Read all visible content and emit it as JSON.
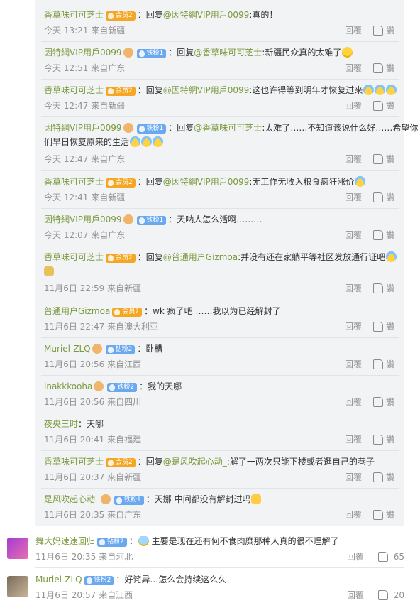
{
  "replies": [
    {
      "user": "香草味可可芝士",
      "badge": "会员2",
      "badge_color": "gold",
      "pre": "回复",
      "mention": "@因特網VIP用戶0099",
      "text": ":真的！",
      "emoji": "",
      "time": "今天 13:21",
      "from": "来自新疆",
      "reply_label": "回覆",
      "like_label": "讚"
    },
    {
      "user": "因特網VIP用戶0099",
      "badge": "铁粉1",
      "badge_color": "blue",
      "pre": "回复",
      "mention": "@香草味可可芝士",
      "text": ":新疆民众真的太难了",
      "emoji": "emoji",
      "time": "今天 12:51",
      "from": "来自广东",
      "reply_label": "回覆",
      "like_label": "讚"
    },
    {
      "user": "香草味可可芝士",
      "badge": "会员2",
      "badge_color": "gold",
      "pre": "回复",
      "mention": "@因特網VIP用戶0099",
      "text": ":这也许得等到明年才恢复过来",
      "emoji": "cry3",
      "time": "今天 12:47",
      "from": "来自新疆",
      "reply_label": "回覆",
      "like_label": "讚"
    },
    {
      "user": "因特網VIP用戶0099",
      "badge": "铁粉1",
      "badge_color": "blue",
      "pre": "回复",
      "mention": "@香草味可可芝士",
      "text": ":太难了……不知道该说什么好……希望你",
      "text2": "们早日恢复原来的生活",
      "emoji": "cry3",
      "time": "今天 12:47",
      "from": "来自广东",
      "reply_label": "回覆",
      "like_label": "讚"
    },
    {
      "user": "香草味可可芝士",
      "badge": "会员2",
      "badge_color": "gold",
      "pre": "回复",
      "mention": "@因特網VIP用戶0099",
      "text": ":无工作无收入粮食疯狂涨价",
      "emoji": "cry",
      "time": "今天 12:41",
      "from": "来自新疆",
      "reply_label": "回覆",
      "like_label": "讚"
    },
    {
      "user": "因特網VIP用戶0099",
      "badge": "铁粉1",
      "badge_color": "blue",
      "pre": "",
      "mention": "",
      "text": "天呐人怎么活啊………",
      "emoji": "",
      "time": "今天 12:07",
      "from": "来自广东",
      "reply_label": "回覆",
      "like_label": "讚"
    },
    {
      "user": "香草味可可芝士",
      "badge": "会员2",
      "badge_color": "gold",
      "pre": "回复",
      "mention": "@普通用户Gizmoa",
      "text": ":并没有还在家躺平等社区发放通行证吧",
      "emoji": "cry",
      "time": "11月6日 22:59",
      "from": "来自新疆",
      "reply_label": "回覆",
      "like_label": "讚"
    },
    {
      "user": "普通用户Gizmoa",
      "badge": "会员2",
      "badge_color": "gold",
      "pre": "",
      "mention": "",
      "text": "wk 疯了吧 ……我以为已经解封了",
      "emoji": "",
      "time": "11月6日 22:47",
      "from": "来自澳大利亚",
      "reply_label": "回覆",
      "like_label": "讚"
    },
    {
      "user": "Muriel-ZLQ",
      "badge": "钻粉2",
      "badge_color": "blue",
      "pre": "",
      "mention": "",
      "text": "卧槽",
      "emoji": "",
      "time": "11月6日 20:56",
      "from": "来自江西",
      "reply_label": "回覆",
      "like_label": "讚"
    },
    {
      "user": "inakkkooha",
      "badge": "铁粉2",
      "badge_color": "blue",
      "pre": "",
      "mention": "",
      "text": "我的天哪",
      "emoji": "",
      "time": "11月6日 20:56",
      "from": "来自四川",
      "reply_label": "回覆",
      "like_label": "讚"
    },
    {
      "user": "夜央三时",
      "badge": "",
      "badge_color": "",
      "pre": "",
      "mention": "",
      "text": "天哪",
      "emoji": "",
      "time": "11月6日 20:41",
      "from": "来自福建",
      "reply_label": "回覆",
      "like_label": "讚"
    },
    {
      "user": "香草味可可芝士",
      "badge": "会员2",
      "badge_color": "gold",
      "pre": "回复",
      "mention": "@是风吹起心动_",
      "text": ":解了一两次只能下楼或者逛自己的巷子",
      "emoji": "",
      "time": "11月6日 20:37",
      "from": "来自新疆",
      "reply_label": "回覆",
      "like_label": "讚"
    },
    {
      "user": "是风吹起心动_",
      "badge": "铁粉1",
      "badge_color": "blue",
      "pre": "",
      "mention": "",
      "text": "天娜 中间都没有解封过吗",
      "emoji": "pray",
      "time": "11月6日 20:35",
      "from": "来自广东",
      "reply_label": "回覆",
      "like_label": "讚"
    }
  ],
  "comments": [
    {
      "user": "舞大妈速速回归",
      "badge": "钻粉2",
      "text": "主要是现在还有何不食肉糜那种人真的很不理解了",
      "time": "11月6日 20:35",
      "from": "来自河北",
      "reply_label": "回覆",
      "likes": "65"
    },
    {
      "user": "Muriel-ZLQ",
      "badge": "铁粉2",
      "text": "好诧异…怎么会持续这么久",
      "time": "11月6日 20:57",
      "from": "来自江西",
      "reply_label": "回覆",
      "likes": "20"
    }
  ]
}
